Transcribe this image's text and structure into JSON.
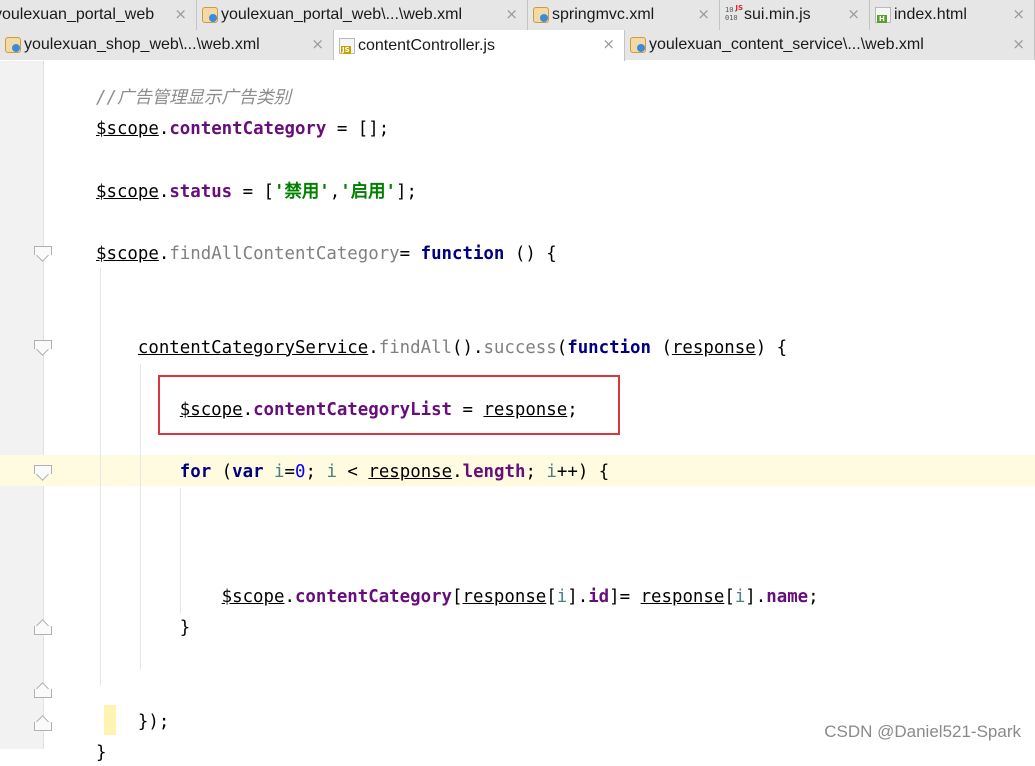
{
  "tabs_row1": [
    {
      "label": "youlexuan_portal_web",
      "icon": "none",
      "active": false
    },
    {
      "label": "youlexuan_portal_web\\...\\web.xml",
      "icon": "xml-file-icon",
      "active": false
    },
    {
      "label": "springmvc.xml",
      "icon": "xml-file-icon",
      "active": false
    },
    {
      "label": "sui.min.js",
      "icon": "binary-js-file-icon",
      "active": false
    },
    {
      "label": "index.html",
      "icon": "html-file-icon",
      "active": false
    }
  ],
  "tabs_row2": [
    {
      "label": "youlexuan_shop_web\\...\\web.xml",
      "icon": "xml-file-icon",
      "active": false
    },
    {
      "label": "contentController.js",
      "icon": "js-file-icon",
      "active": true
    },
    {
      "label": "youlexuan_content_service\\...\\web.xml",
      "icon": "xml-file-icon",
      "active": false
    }
  ],
  "close_glyph": "×",
  "code_lines": [
    [
      {
        "t": "//广告管理显示广告类别",
        "c": "cm"
      }
    ],
    [
      {
        "t": "$scope",
        "c": "ul"
      },
      {
        "t": ".",
        "c": ""
      },
      {
        "t": "contentCategory",
        "c": "prop"
      },
      {
        "t": " = [];",
        "c": ""
      }
    ],
    [],
    [
      {
        "t": "$scope",
        "c": "ul"
      },
      {
        "t": ".",
        "c": ""
      },
      {
        "t": "status",
        "c": "prop"
      },
      {
        "t": " = [",
        "c": ""
      },
      {
        "t": "'禁用'",
        "c": "str"
      },
      {
        "t": ",",
        "c": ""
      },
      {
        "t": "'启用'",
        "c": "str"
      },
      {
        "t": "];",
        "c": ""
      }
    ],
    [],
    [
      {
        "t": "$scope",
        "c": "ul"
      },
      {
        "t": ".",
        "c": ""
      },
      {
        "t": "findAllContentCategory",
        "c": "fn"
      },
      {
        "t": "= ",
        "c": ""
      },
      {
        "t": "function",
        "c": "kw"
      },
      {
        "t": " () {",
        "c": ""
      }
    ],
    [],
    [],
    [
      {
        "t": "    ",
        "c": ""
      },
      {
        "t": "contentCategoryService",
        "c": "ul"
      },
      {
        "t": ".",
        "c": ""
      },
      {
        "t": "findAll",
        "c": "fn"
      },
      {
        "t": "().",
        "c": ""
      },
      {
        "t": "success",
        "c": "fn"
      },
      {
        "t": "(",
        "c": ""
      },
      {
        "t": "function",
        "c": "kw"
      },
      {
        "t": " (",
        "c": ""
      },
      {
        "t": "response",
        "c": "ul"
      },
      {
        "t": ") {",
        "c": ""
      }
    ],
    [],
    [
      {
        "t": "        ",
        "c": ""
      },
      {
        "t": "$scope",
        "c": "ul"
      },
      {
        "t": ".",
        "c": ""
      },
      {
        "t": "contentCategoryList",
        "c": "prop"
      },
      {
        "t": " = ",
        "c": ""
      },
      {
        "t": "response",
        "c": "ul"
      },
      {
        "t": ";",
        "c": ""
      }
    ],
    [],
    [
      {
        "t": "        ",
        "c": ""
      },
      {
        "t": "for",
        "c": "kw"
      },
      {
        "t": " (",
        "c": ""
      },
      {
        "t": "var",
        "c": "kw"
      },
      {
        "t": " ",
        "c": ""
      },
      {
        "t": "i",
        "c": "var"
      },
      {
        "t": "=",
        "c": ""
      },
      {
        "t": "0",
        "c": "num"
      },
      {
        "t": "; ",
        "c": ""
      },
      {
        "t": "i",
        "c": "var"
      },
      {
        "t": " < ",
        "c": ""
      },
      {
        "t": "response",
        "c": "ul"
      },
      {
        "t": ".",
        "c": ""
      },
      {
        "t": "length",
        "c": "prop"
      },
      {
        "t": "; ",
        "c": ""
      },
      {
        "t": "i",
        "c": "var"
      },
      {
        "t": "++) {",
        "c": ""
      }
    ],
    [],
    [],
    [],
    [
      {
        "t": "            ",
        "c": ""
      },
      {
        "t": "$scope",
        "c": "ul"
      },
      {
        "t": ".",
        "c": ""
      },
      {
        "t": "contentCategory",
        "c": "prop"
      },
      {
        "t": "[",
        "c": ""
      },
      {
        "t": "response",
        "c": "ul"
      },
      {
        "t": "[",
        "c": ""
      },
      {
        "t": "i",
        "c": "var"
      },
      {
        "t": "].",
        "c": ""
      },
      {
        "t": "id",
        "c": "prop"
      },
      {
        "t": "]= ",
        "c": ""
      },
      {
        "t": "response",
        "c": "ul"
      },
      {
        "t": "[",
        "c": ""
      },
      {
        "t": "i",
        "c": "var"
      },
      {
        "t": "].",
        "c": ""
      },
      {
        "t": "name",
        "c": "prop"
      },
      {
        "t": ";",
        "c": ""
      }
    ],
    [
      {
        "t": "        }",
        "c": ""
      }
    ],
    [],
    [],
    [
      {
        "t": "    });",
        "c": ""
      }
    ],
    [
      {
        "t": "}",
        "c": ""
      }
    ]
  ],
  "watermark": "CSDN @Daniel521-Spark"
}
